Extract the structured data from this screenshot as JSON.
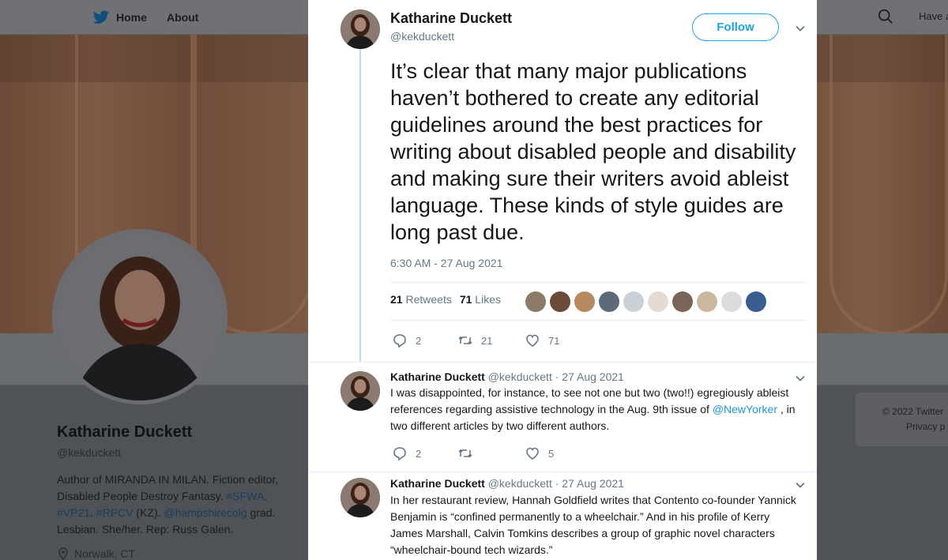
{
  "background": {
    "nav": {
      "home": "Home",
      "about": "About"
    },
    "topright": "Have a",
    "profile": {
      "name": "Katharine Duckett",
      "handle": "@kekduckett",
      "bio": {
        "p1": "Author of MIRANDA IN MILAN. Fiction editor, Disabled People Destroy Fantasy. ",
        "tag_sfwa": "#SFWA",
        "p2": ".",
        "tag_vp21": "#VP21",
        "p3": ". ",
        "tag_rpcv": "#RPCV",
        "p4": " (KZ). ",
        "mention": "@hampshirecolg",
        "p5": " grad. Lesbian. She/her. Rep: Russ Galen."
      },
      "location": "Norwalk, CT"
    },
    "footer": {
      "copyright": "© 2022 Twitter",
      "privacy": "Privacy p"
    }
  },
  "tweet": {
    "author_name": "Katharine Duckett",
    "author_handle": "@kekduckett",
    "follow_label": "Follow",
    "text": "It’s clear that many major publications haven’t bothered to create any editorial guidelines around the best practices for writing about disabled people and disability and making sure their writers avoid ableist language. These kinds of style guides are long past due.",
    "timestamp": "6:30 AM - 27 Aug 2021",
    "retweets_count": "21",
    "retweets_label": "Retweets",
    "likes_count": "71",
    "likes_label": "Likes",
    "actions": {
      "replies": "2",
      "retweets": "21",
      "likes": "71"
    }
  },
  "replies": [
    {
      "name": "Katharine Duckett",
      "handle": "@kekduckett",
      "date": "27 Aug 2021",
      "text_a": "I was disappointed, for instance, to see not one but two (two!!) egregiously ableist references regarding assistive technology in the Aug. 9th issue of ",
      "mention": "@NewYorker",
      "text_b": " , in two different articles by two different authors.",
      "replies": "2",
      "retweets": "",
      "likes": "5"
    },
    {
      "name": "Katharine Duckett",
      "handle": "@kekduckett",
      "date": "27 Aug 2021",
      "text": "In her restaurant review, Hannah Goldfield writes that Contento co-founder Yannick Benjamin is “confined permanently to a wheelchair.” And in his profile of Kerry James Marshall, Calvin Tomkins describes a group of graphic novel characters “wheelchair-bound tech wizards.”"
    }
  ],
  "colors": {
    "twitter_blue": "#1da1f2",
    "thread_line": "#c5dbee",
    "muted_text": "#657786"
  },
  "icons": [
    "twitter-bird-icon",
    "search-icon",
    "location-pin-icon",
    "chevron-down-icon",
    "reply-icon",
    "retweet-icon",
    "heart-icon"
  ]
}
